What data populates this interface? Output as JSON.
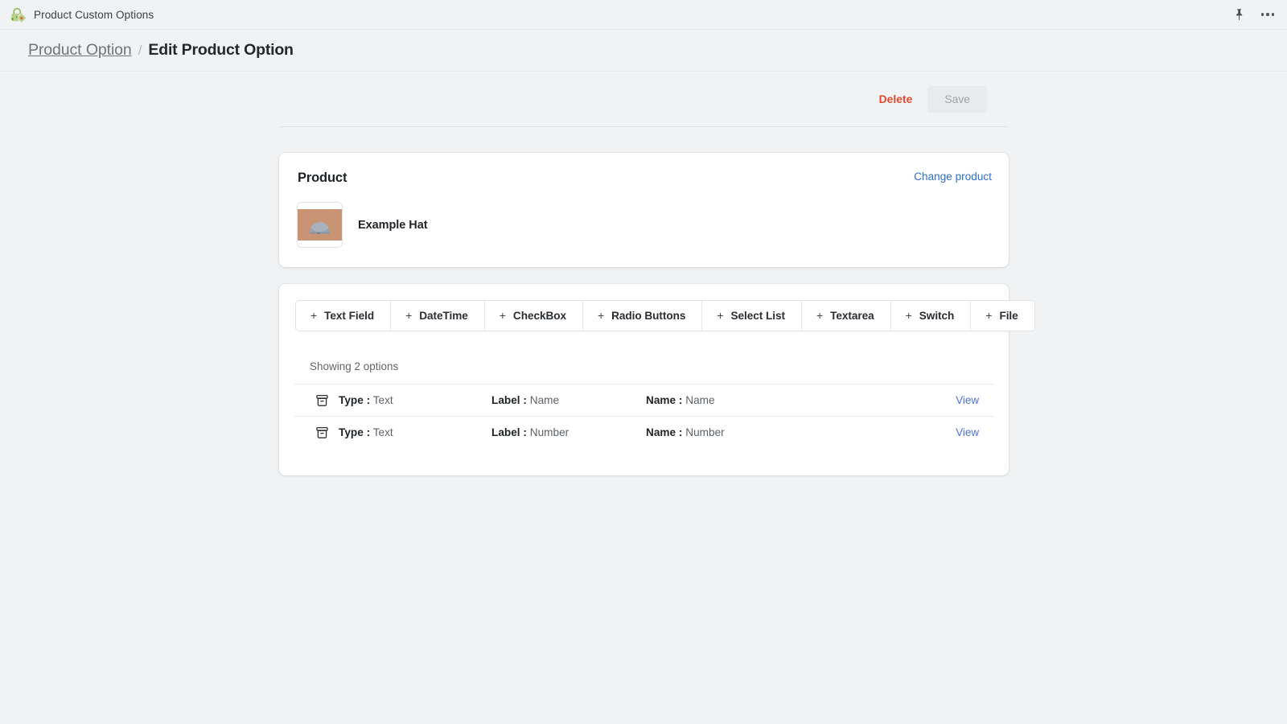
{
  "appbar": {
    "icon": "lock-gear-icon",
    "title": "Product Custom Options",
    "pin_icon": "pin-icon",
    "more_icon": "more-options-icon"
  },
  "breadcrumb": {
    "parent": "Product Option",
    "separator": "/",
    "current": "Edit Product Option"
  },
  "actions": {
    "delete_label": "Delete",
    "save_label": "Save"
  },
  "product_card": {
    "title": "Product",
    "change_link": "Change product",
    "product_name": "Example Hat",
    "thumbnail_icon": "product-hat-thumbnail"
  },
  "options_card": {
    "type_buttons": [
      {
        "plus": "+",
        "label": "Text Field"
      },
      {
        "plus": "+",
        "label": "DateTime"
      },
      {
        "plus": "+",
        "label": "CheckBox"
      },
      {
        "plus": "+",
        "label": "Radio Buttons"
      },
      {
        "plus": "+",
        "label": "Select List"
      },
      {
        "plus": "+",
        "label": "Textarea"
      },
      {
        "plus": "+",
        "label": "Switch"
      },
      {
        "plus": "+",
        "label": "File"
      }
    ],
    "showing": "Showing 2 options",
    "rows": [
      {
        "icon": "archive-box-icon",
        "type_key": "Type :",
        "type_value": "Text",
        "label_key": "Label :",
        "label_value": "Name",
        "name_key": "Name :",
        "name_value": "Name",
        "view": "View"
      },
      {
        "icon": "archive-box-icon",
        "type_key": "Type :",
        "type_value": "Text",
        "label_key": "Label :",
        "label_value": "Number",
        "name_key": "Name :",
        "name_value": "Number",
        "view": "View"
      }
    ]
  },
  "colors": {
    "page_bg": "#f1f2f3",
    "card_bg": "#ffffff",
    "delete_red": "#e0482f",
    "link_blue": "#2c6ecb",
    "view_blue": "#4a6fe0",
    "accent_green": "#9cba6a",
    "thumb_bg": "#c89473"
  }
}
